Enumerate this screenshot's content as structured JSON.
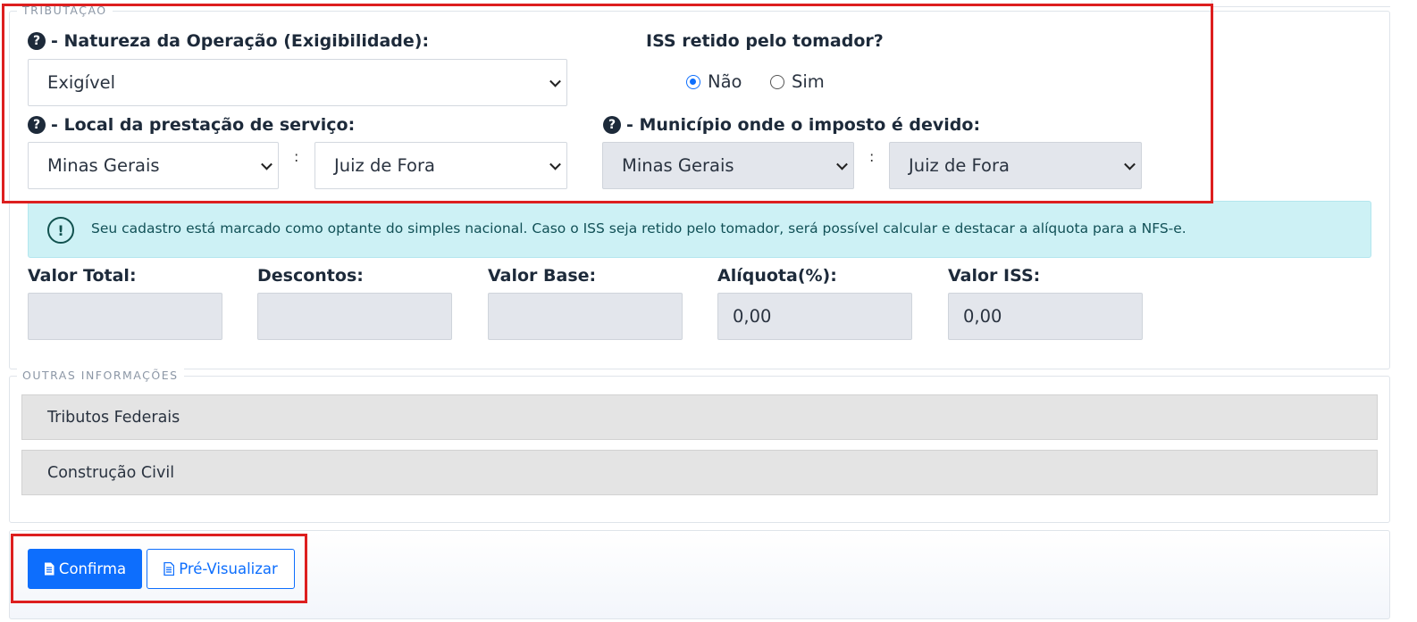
{
  "tributacao": {
    "legend": "TRIBUTAÇÃO",
    "natureza_label": "- Natureza da Operação (Exigibilidade):",
    "natureza_value": "Exigível",
    "iss_retido_label": "ISS retido pelo tomador?",
    "iss_retido_options": [
      {
        "label": "Não",
        "selected": true
      },
      {
        "label": "Sim",
        "selected": false
      }
    ],
    "local_label": "- Local da prestação de serviço:",
    "local_estado": "Minas Gerais",
    "local_municipio": "Juiz de Fora",
    "municipio_devido_label": "- Município onde o imposto é devido:",
    "devido_estado": "Minas Gerais",
    "devido_municipio": "Juiz de Fora",
    "separator": ":",
    "help_icon": "question-circle-icon"
  },
  "alert": {
    "icon": "exclamation-circle-icon",
    "text": "Seu cadastro está marcado como optante do simples nacional. Caso o ISS seja retido pelo tomador, será possível calcular e destacar a alíquota para a NFS-e."
  },
  "valores": [
    {
      "label": "Valor Total:",
      "value": ""
    },
    {
      "label": "Descontos:",
      "value": ""
    },
    {
      "label": "Valor Base:",
      "value": ""
    },
    {
      "label": "Alíquota(%):",
      "value": "0,00"
    },
    {
      "label": "Valor ISS:",
      "value": "0,00"
    }
  ],
  "outras": {
    "legend": "OUTRAS INFORMAÇÕES",
    "items": [
      "Tributos Federais",
      "Construção Civil"
    ]
  },
  "actions": {
    "confirma": "Confirma",
    "previsualizar": "Pré-Visualizar",
    "icon": "file-text-icon"
  },
  "colors": {
    "primary": "#0d6efd",
    "highlight": "#dd1f1f",
    "alert_bg": "#cdf1f5"
  }
}
